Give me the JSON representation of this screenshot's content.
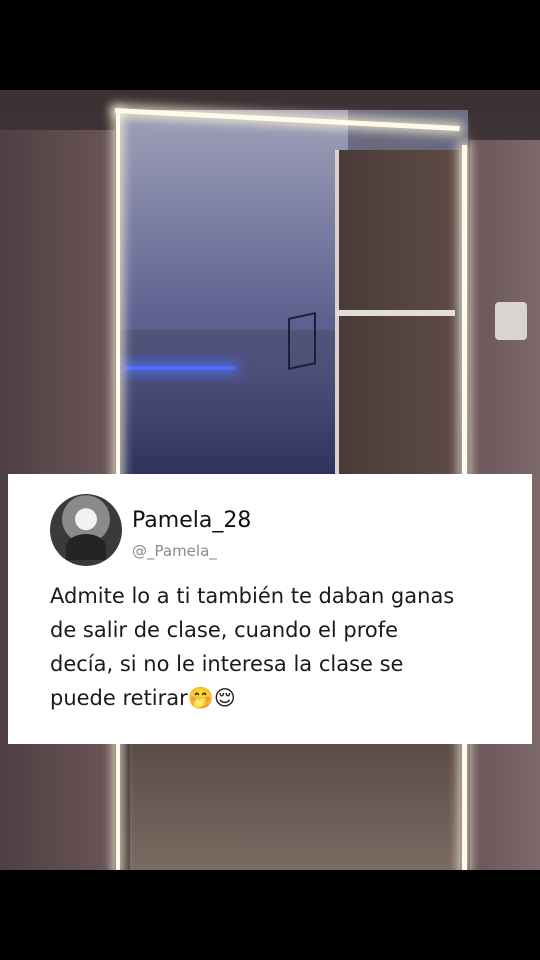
{
  "post": {
    "display_name": "Pamela_28",
    "handle": "@_Pamela_",
    "text": "Admite lo a ti también te daban ganas\nde  salir de clase, cuando el profe\ndecía, si no le interesa la clase se\npuede retirar🤭😌"
  },
  "icons": {
    "avatar": "profile-photo-avatar"
  },
  "colors": {
    "card_background": "#ffffff",
    "name_color": "#111111",
    "handle_color": "#8a8a8a",
    "led_color": "#fffbe6",
    "accent_blue_light": "#4e6bff"
  }
}
